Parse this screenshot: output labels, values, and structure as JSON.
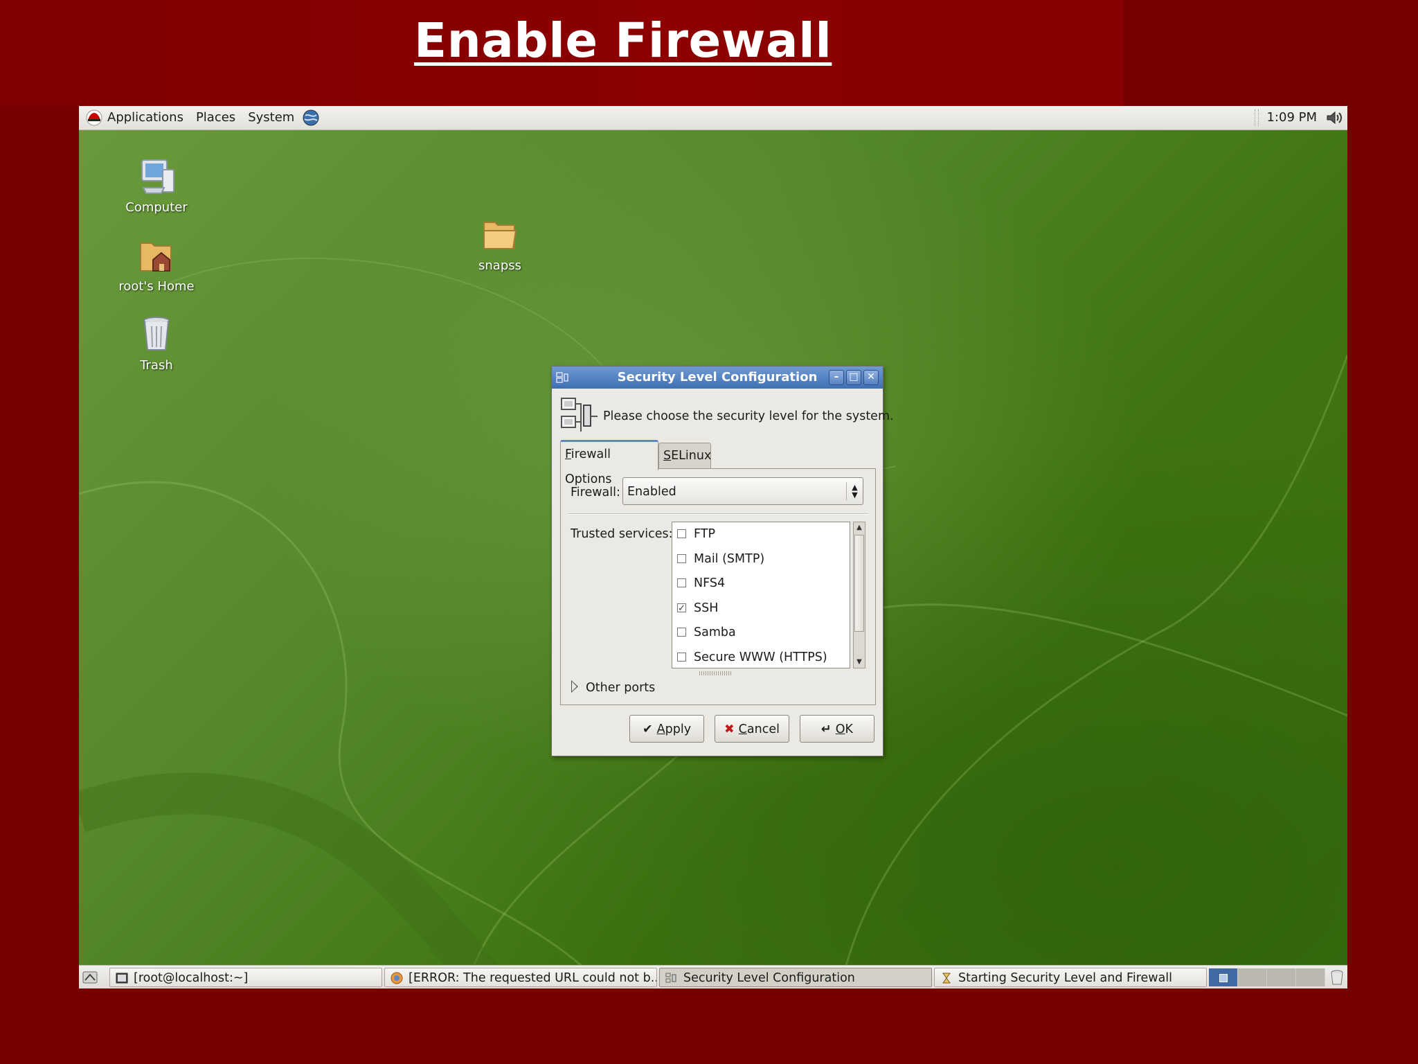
{
  "slide": {
    "title": "Enable Firewall"
  },
  "top_panel": {
    "menus": [
      "Applications",
      "Places",
      "System"
    ],
    "clock": "1:09 PM"
  },
  "desktop_icons": {
    "computer": "Computer",
    "home": "root's Home",
    "trash": "Trash",
    "folder": "snapss"
  },
  "dialog": {
    "title": "Security Level Configuration",
    "header_text": "Please choose the security level for the system.",
    "tabs": [
      {
        "label": "Firewall Options",
        "mnemonic": "F",
        "rest": "irewall Options",
        "active": true
      },
      {
        "label": "SELinux",
        "mnemonic": "S",
        "rest": "ELinux",
        "active": false
      }
    ],
    "firewall_label": "Firewall:",
    "firewall_value": "Enabled",
    "trusted_label": "Trusted services:",
    "services": [
      {
        "label": "FTP",
        "checked": false
      },
      {
        "label": "Mail (SMTP)",
        "checked": false
      },
      {
        "label": "NFS4",
        "checked": false
      },
      {
        "label": "SSH",
        "checked": true
      },
      {
        "label": "Samba",
        "checked": false
      },
      {
        "label": "Secure WWW (HTTPS)",
        "checked": false
      }
    ],
    "other_ports": "Other ports",
    "buttons": {
      "apply": {
        "mnemonic": "A",
        "rest": "pply"
      },
      "cancel": {
        "mnemonic": "C",
        "rest": "ancel"
      },
      "ok": {
        "mnemonic": "O",
        "rest": "K"
      }
    }
  },
  "taskbar": {
    "tasks": [
      {
        "label": "[root@localhost:~]",
        "active": false
      },
      {
        "label": "[ERROR: The requested URL could not b...",
        "active": false
      },
      {
        "label": "Security Level Configuration",
        "active": true
      },
      {
        "label": "Starting Security Level and Firewall",
        "active": false
      }
    ]
  },
  "colors": {
    "slide_bg": "#760000",
    "titlebar": "#4a78bb",
    "desktop": "#4d8220"
  }
}
